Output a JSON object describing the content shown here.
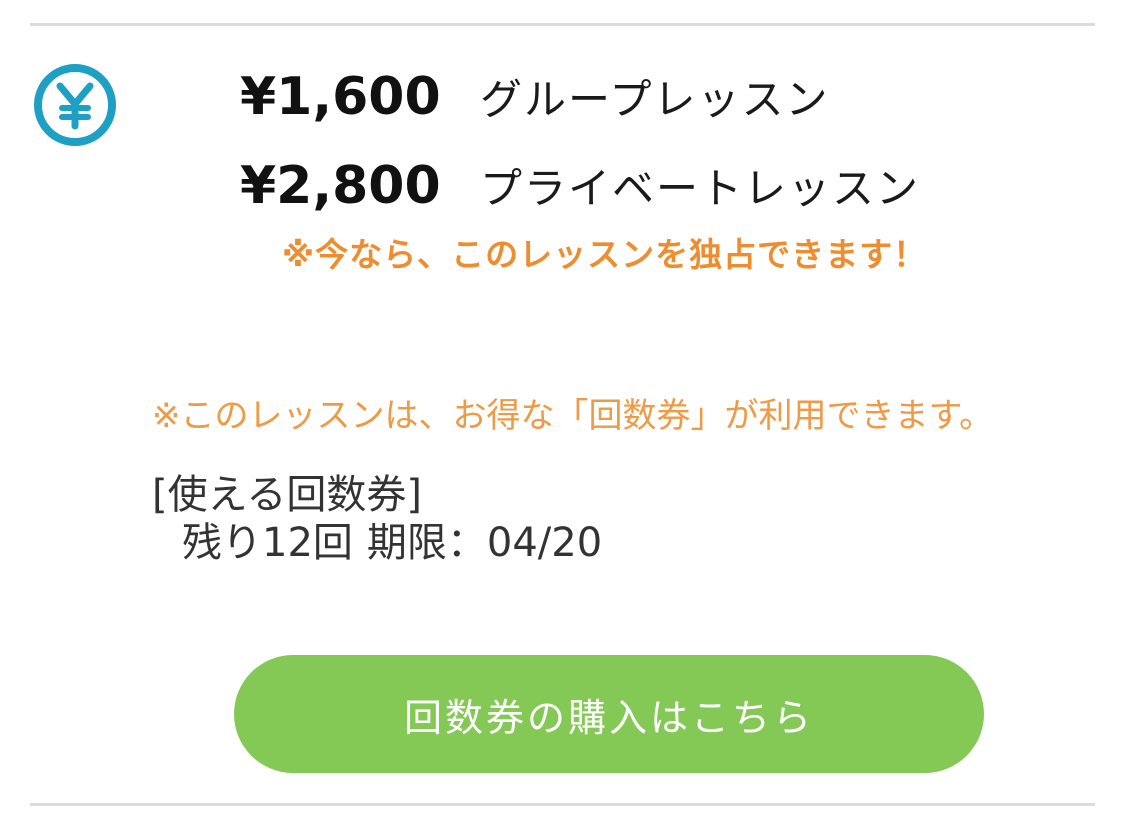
{
  "prices": [
    {
      "amount": "¥1,600",
      "label": "グループレッスン"
    },
    {
      "amount": "¥2,800",
      "label": "プライベートレッスン"
    }
  ],
  "exclusive_note": "※今なら、このレッスンを独占できます！",
  "ticket_note": "※このレッスンは、お得な「回数券」が利用できます。",
  "ticket": {
    "heading": "[使える回数券]",
    "remaining": "残り12回",
    "expiry_label": "期限：",
    "expiry_value": "04/20"
  },
  "buy_button_label": "回数券の購入はこちら",
  "colors": {
    "icon": "#1e9fc4",
    "accent_orange": "#ef8c2d",
    "button_green": "#84c956"
  },
  "icons": {
    "price_icon": "yen-icon"
  }
}
